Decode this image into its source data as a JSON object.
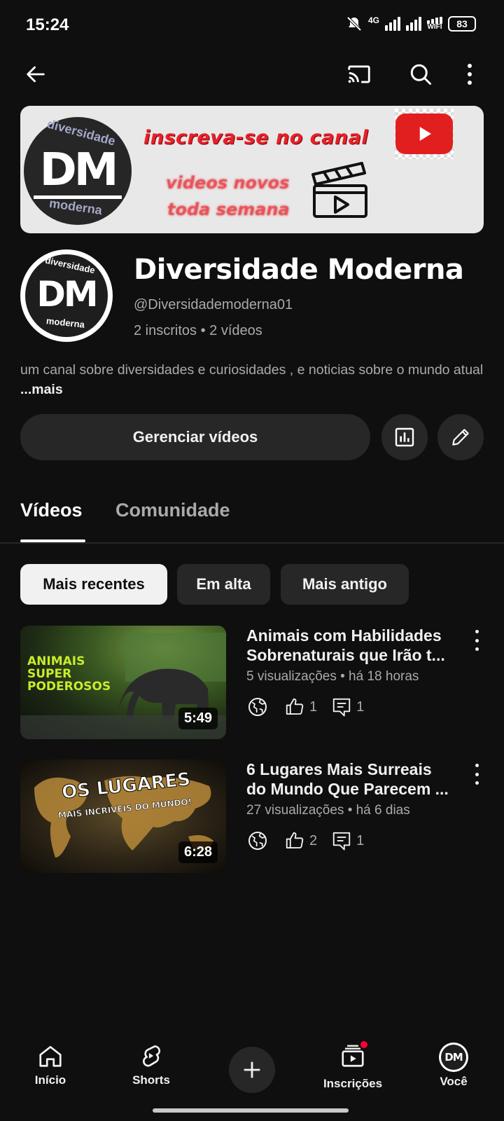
{
  "status_bar": {
    "time": "15:24",
    "network": "4G",
    "wifi": "WIFI",
    "battery": "83"
  },
  "banner": {
    "logo_top": "diversidade",
    "logo_mark": "DM",
    "logo_bottom": "moderna",
    "line1": "inscreva-se no canal",
    "line2": "videos novos",
    "line3": "toda semana"
  },
  "channel": {
    "avatar_top": "diversidade",
    "avatar_mark": "DM",
    "avatar_bottom": "moderna",
    "name": "Diversidade Moderna",
    "handle": "@Diversidademoderna01",
    "stats": "2 inscritos • 2 vídeos",
    "description": "um canal sobre diversidades e  curiosidades , e noticias sobre o mundo atual ",
    "more": "...mais"
  },
  "actions": {
    "manage_label": "Gerenciar vídeos"
  },
  "tabs": [
    {
      "label": "Vídeos",
      "active": true
    },
    {
      "label": "Comunidade",
      "active": false
    }
  ],
  "chips": [
    {
      "label": "Mais recentes",
      "selected": true
    },
    {
      "label": "Em alta",
      "selected": false
    },
    {
      "label": "Mais antigo",
      "selected": false
    }
  ],
  "videos": [
    {
      "title_line1": "Animais com Habilidades",
      "title_line2": "Sobrenaturais que Irão t...",
      "meta": "5 visualizações • há 18 horas",
      "likes": "1",
      "comments": "1",
      "duration": "5:49",
      "thumb_text": [
        "ANIMAIS",
        "SUPER",
        "PODEROSOS"
      ]
    },
    {
      "title_line1": "6 Lugares Mais Surreais",
      "title_line2": "do Mundo Que Parecem ...",
      "meta": "27 visualizações • há 6 dias",
      "likes": "2",
      "comments": "1",
      "duration": "6:28",
      "thumb_text": [
        "OS LUGARES",
        "MAIS INCRÍVEIS DO MUNDO!"
      ]
    }
  ],
  "bottom_nav": {
    "home": "Início",
    "shorts": "Shorts",
    "subscriptions": "Inscrições",
    "you": "Você",
    "you_avatar": "DM"
  },
  "colors": {
    "background": "#0f0f0f",
    "surface": "#272727",
    "text_primary": "#f1f1f1",
    "text_secondary": "#aaaaaa",
    "accent_red": "#e21f1f"
  }
}
